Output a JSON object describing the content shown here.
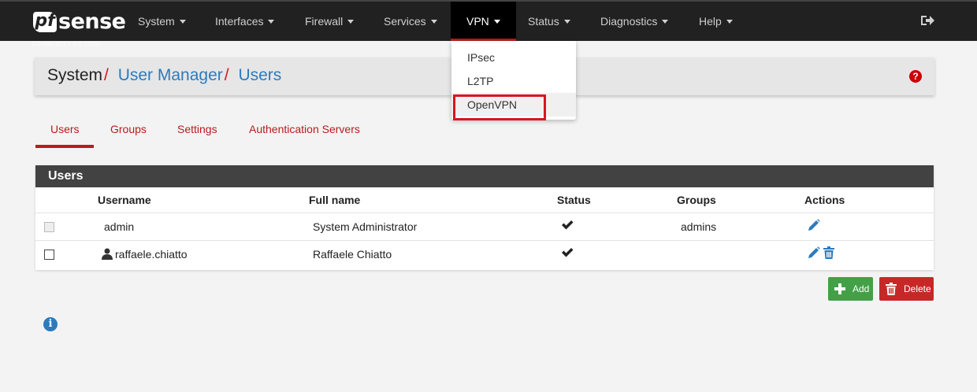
{
  "brand": {
    "logo_text": "sense",
    "logo_badge": "pf",
    "edition": "COMMUNITY EDITION"
  },
  "nav": {
    "items": [
      {
        "label": "System"
      },
      {
        "label": "Interfaces"
      },
      {
        "label": "Firewall"
      },
      {
        "label": "Services"
      },
      {
        "label": "VPN"
      },
      {
        "label": "Status"
      },
      {
        "label": "Diagnostics"
      },
      {
        "label": "Help"
      }
    ],
    "active": "VPN",
    "logout_icon": "sign-out-icon"
  },
  "vpn_menu": {
    "items": [
      {
        "label": "IPsec"
      },
      {
        "label": "L2TP"
      },
      {
        "label": "OpenVPN"
      }
    ],
    "highlighted": "OpenVPN"
  },
  "breadcrumb": {
    "root": "System",
    "separator": "/",
    "level1": "User Manager",
    "level2": "Users",
    "help_icon": "question-circle-icon"
  },
  "tabs": [
    {
      "label": "Users"
    },
    {
      "label": "Groups"
    },
    {
      "label": "Settings"
    },
    {
      "label": "Authentication Servers"
    }
  ],
  "users_panel": {
    "title": "Users",
    "columns": {
      "username": "Username",
      "fullname": "Full name",
      "status": "Status",
      "groups": "Groups",
      "actions": "Actions"
    },
    "rows": [
      {
        "username": "admin",
        "fullname": "System Administrator",
        "status": "enabled",
        "groups": "admins",
        "checkbox_disabled": true,
        "deletable": false
      },
      {
        "username": "raffaele.chiatto",
        "fullname": "Raffaele Chiatto",
        "status": "enabled",
        "groups": "",
        "checkbox_disabled": false,
        "deletable": true
      }
    ]
  },
  "buttons": {
    "add": "Add",
    "delete": "Delete"
  },
  "colors": {
    "accent_red": "#b71c1c",
    "link_blue": "#2c7bbd",
    "add_green": "#43a047",
    "delete_red": "#c62828",
    "navbar": "#212121"
  }
}
